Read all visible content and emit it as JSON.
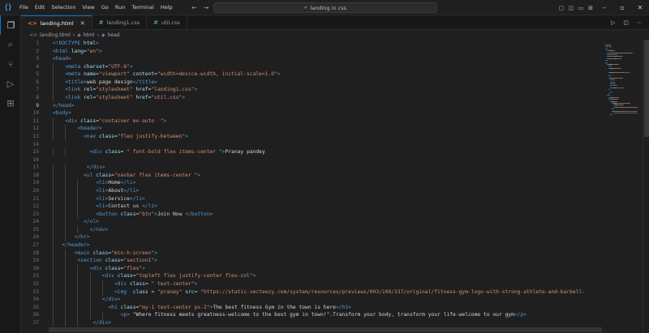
{
  "titlebar": {
    "menu": [
      "File",
      "Edit",
      "Selection",
      "View",
      "Go",
      "Run",
      "Terminal",
      "Help"
    ],
    "search_text": "landing in css"
  },
  "tabs": [
    {
      "label": "landing.html",
      "type": "html",
      "active": true
    },
    {
      "label": "landing1.css",
      "type": "css",
      "active": false
    },
    {
      "label": "util.css",
      "type": "css",
      "active": false
    }
  ],
  "breadcrumb": {
    "file": "landing.html",
    "el1": "html",
    "el2": "head"
  },
  "editor": {
    "current_line": 9,
    "lines": [
      {
        "n": "1",
        "indent": 0,
        "tokens": [
          [
            "t-doc",
            "<!DOCTYPE "
          ],
          [
            "t-attr",
            "html"
          ],
          [
            "t-doc",
            ">"
          ]
        ]
      },
      {
        "n": "2",
        "indent": 0,
        "tokens": [
          [
            "t-tag",
            "<html "
          ],
          [
            "t-attr",
            "lang"
          ],
          [
            "t-txt",
            "="
          ],
          [
            "t-str",
            "\"en\""
          ],
          [
            "t-tag",
            ">"
          ]
        ]
      },
      {
        "n": "3",
        "indent": 0,
        "tokens": [
          [
            "t-tag",
            "<head>"
          ]
        ]
      },
      {
        "n": "4",
        "indent": 1,
        "tokens": [
          [
            "t-tag",
            "<meta "
          ],
          [
            "t-attr",
            "charset"
          ],
          [
            "t-txt",
            "="
          ],
          [
            "t-str",
            "\"UTF-8\""
          ],
          [
            "t-tag",
            ">"
          ]
        ]
      },
      {
        "n": "5",
        "indent": 1,
        "tokens": [
          [
            "t-tag",
            "<meta "
          ],
          [
            "t-attr",
            "name"
          ],
          [
            "t-txt",
            "="
          ],
          [
            "t-str",
            "\"viewport\" "
          ],
          [
            "t-attr",
            "content"
          ],
          [
            "t-txt",
            "="
          ],
          [
            "t-str",
            "\"width=device-width, initial-scale=1.0\""
          ],
          [
            "t-tag",
            ">"
          ]
        ]
      },
      {
        "n": "6",
        "indent": 1,
        "tokens": [
          [
            "t-tag",
            "<title>"
          ],
          [
            "t-txt",
            "web page design"
          ],
          [
            "t-tag",
            "</title>"
          ]
        ]
      },
      {
        "n": "7",
        "indent": 1,
        "tokens": [
          [
            "t-tag",
            "<link "
          ],
          [
            "t-attr",
            "rel"
          ],
          [
            "t-txt",
            "="
          ],
          [
            "t-str",
            "\"stylesheet\" "
          ],
          [
            "t-attr",
            "href"
          ],
          [
            "t-txt",
            "="
          ],
          [
            "t-str",
            "\"landing1.css\""
          ],
          [
            "t-tag",
            ">"
          ]
        ]
      },
      {
        "n": "8",
        "indent": 1,
        "tokens": [
          [
            "t-tag",
            "<link "
          ],
          [
            "t-attr",
            "rel"
          ],
          [
            "t-txt",
            "="
          ],
          [
            "t-str",
            "\"stylesheet\" "
          ],
          [
            "t-attr",
            "href"
          ],
          [
            "t-txt",
            "="
          ],
          [
            "t-str",
            "\"util.css\""
          ],
          [
            "t-tag",
            ">"
          ]
        ]
      },
      {
        "n": "9",
        "indent": 0,
        "tokens": [
          [
            "t-tag",
            "</head>"
          ]
        ]
      },
      {
        "n": "10",
        "indent": 0,
        "tokens": [
          [
            "t-tag",
            "<body>"
          ]
        ]
      },
      {
        "n": "11",
        "indent": 1,
        "tokens": [
          [
            "t-tag",
            "<div "
          ],
          [
            "t-attr",
            "class"
          ],
          [
            "t-txt",
            "="
          ],
          [
            "t-str",
            "\"container mx-auto  \""
          ],
          [
            "t-tag",
            ">"
          ]
        ]
      },
      {
        "n": "12",
        "indent": 2,
        "tokens": [
          [
            "t-tag",
            "<header>"
          ]
        ]
      },
      {
        "n": "13",
        "indent": 2,
        "extra": 2,
        "tokens": [
          [
            "t-tag",
            "<nav "
          ],
          [
            "t-attr",
            "class"
          ],
          [
            "t-txt",
            "="
          ],
          [
            "t-str",
            "\"flex justify-between\""
          ],
          [
            "t-tag",
            ">"
          ]
        ]
      },
      {
        "n": "14",
        "indent": 0,
        "tokens": []
      },
      {
        "n": "15",
        "indent": 2,
        "extra": 4,
        "tokens": [
          [
            "t-tag",
            "<div "
          ],
          [
            "t-attr",
            "class"
          ],
          [
            "t-txt",
            "= "
          ],
          [
            "t-str",
            "\" font-bold flex items-center \""
          ],
          [
            "t-tag",
            ">"
          ],
          [
            "t-txt",
            "Pranay pandey"
          ]
        ]
      },
      {
        "n": "16",
        "indent": 0,
        "tokens": []
      },
      {
        "n": "17",
        "indent": 2,
        "extra": 3,
        "tokens": [
          [
            "t-tag",
            "</div>"
          ]
        ]
      },
      {
        "n": "18",
        "indent": 2,
        "extra": 2,
        "tokens": [
          [
            "t-tag",
            "<ul "
          ],
          [
            "t-attr",
            "class"
          ],
          [
            "t-txt",
            "="
          ],
          [
            "t-str",
            "\"navbar flex items-center \""
          ],
          [
            "t-tag",
            ">"
          ]
        ]
      },
      {
        "n": "19",
        "indent": 3,
        "extra": 2,
        "tokens": [
          [
            "t-tag",
            "<li>"
          ],
          [
            "t-txt",
            "Home"
          ],
          [
            "t-tag",
            "</li>"
          ]
        ]
      },
      {
        "n": "20",
        "indent": 3,
        "extra": 2,
        "tokens": [
          [
            "t-tag",
            "<li>"
          ],
          [
            "t-txt",
            "About"
          ],
          [
            "t-tag",
            "</li>"
          ]
        ]
      },
      {
        "n": "21",
        "indent": 3,
        "extra": 2,
        "tokens": [
          [
            "t-tag",
            "<li>"
          ],
          [
            "t-txt",
            "Service"
          ],
          [
            "t-tag",
            "</li>"
          ]
        ]
      },
      {
        "n": "22",
        "indent": 3,
        "extra": 2,
        "tokens": [
          [
            "t-tag",
            "<li>"
          ],
          [
            "t-txt",
            "Contact us "
          ],
          [
            "t-tag",
            "</li>"
          ]
        ]
      },
      {
        "n": "23",
        "indent": 3,
        "extra": 2,
        "tokens": [
          [
            "t-tag",
            "<button "
          ],
          [
            "t-attr",
            "class"
          ],
          [
            "t-txt",
            "="
          ],
          [
            "t-str",
            "\"btn\""
          ],
          [
            "t-tag",
            ">"
          ],
          [
            "t-txt",
            "Join Now "
          ],
          [
            "t-tag",
            "</button>"
          ]
        ]
      },
      {
        "n": "24",
        "indent": 2,
        "extra": 2,
        "tokens": [
          [
            "t-tag",
            "</ul>"
          ]
        ]
      },
      {
        "n": "25",
        "indent": 3,
        "extra": 0,
        "tokens": [
          [
            "t-tag",
            "</nav>"
          ]
        ]
      },
      {
        "n": "26",
        "indent": 2,
        "extra": -1,
        "tokens": [
          [
            "t-tag",
            "</hr>"
          ]
        ]
      },
      {
        "n": "27",
        "indent": 1,
        "extra": -1,
        "tokens": [
          [
            "t-tag",
            "</header>"
          ]
        ]
      },
      {
        "n": "28",
        "indent": 2,
        "extra": -1,
        "tokens": [
          [
            "t-tag",
            "<main "
          ],
          [
            "t-attr",
            "class"
          ],
          [
            "t-txt",
            "="
          ],
          [
            "t-str",
            "\"min-h-screen\""
          ],
          [
            "t-tag",
            ">"
          ]
        ]
      },
      {
        "n": "29",
        "indent": 2,
        "extra": 0,
        "tokens": [
          [
            "t-tag",
            "<section "
          ],
          [
            "t-attr",
            "class"
          ],
          [
            "t-txt",
            "="
          ],
          [
            "t-str",
            "\"section1\""
          ],
          [
            "t-tag",
            ">"
          ]
        ]
      },
      {
        "n": "30",
        "indent": 3,
        "extra": 0,
        "tokens": [
          [
            "t-tag",
            "<div "
          ],
          [
            "t-attr",
            "class"
          ],
          [
            "t-txt",
            "="
          ],
          [
            "t-str",
            "\"flex\""
          ],
          [
            "t-tag",
            ">"
          ]
        ]
      },
      {
        "n": "31",
        "indent": 4,
        "extra": 0,
        "tokens": [
          [
            "t-tag",
            "<div "
          ],
          [
            "t-attr",
            "class"
          ],
          [
            "t-txt",
            "="
          ],
          [
            "t-str",
            "\"topleft flex justify-center flex-col\""
          ],
          [
            "t-tag",
            ">"
          ]
        ]
      },
      {
        "n": "32",
        "indent": 5,
        "extra": 0,
        "tokens": [
          [
            "t-tag",
            "<div "
          ],
          [
            "t-attr",
            "class"
          ],
          [
            "t-txt",
            "= "
          ],
          [
            "t-str",
            "\" text-center\""
          ],
          [
            "t-tag",
            ">"
          ]
        ]
      },
      {
        "n": "33",
        "indent": 5,
        "extra": 0,
        "tokens": [
          [
            "t-tag",
            "<img  "
          ],
          [
            "t-attr",
            "class"
          ],
          [
            "t-txt",
            " = "
          ],
          [
            "t-str",
            "\"pranay\" "
          ],
          [
            "t-attr",
            "src"
          ],
          [
            "t-txt",
            "= "
          ],
          [
            "t-str",
            "\"https://static.vecteezy.com/system/resources/previews/003/108/337/original/fitness-gym-logo-with-strong-athlete-and-barbell-"
          ]
        ]
      },
      {
        "n": "34",
        "indent": 4,
        "extra": 0,
        "tokens": [
          [
            "t-tag",
            "</div>"
          ]
        ]
      },
      {
        "n": "35",
        "indent": 4,
        "extra": 2,
        "tokens": [
          [
            "t-tag",
            "<h1 "
          ],
          [
            "t-attr",
            "class"
          ],
          [
            "t-txt",
            "="
          ],
          [
            "t-str",
            "\"my-1 text-center px-2\""
          ],
          [
            "t-tag",
            ">"
          ],
          [
            "t-txt",
            "The best fitness Gym in the town is here"
          ],
          [
            "t-tag",
            "</h1>"
          ]
        ]
      },
      {
        "n": "36",
        "indent": 5,
        "extra": 2,
        "tokens": [
          [
            "t-tag",
            "<p> "
          ],
          [
            "t-txt",
            "\"Where fitness meets greatness-welcome to the best gym in town!\".Transform your body, transform your life-welcome to our gym"
          ],
          [
            "t-tag",
            "</p>"
          ]
        ]
      },
      {
        "n": "37",
        "indent": 3,
        "extra": 1,
        "tokens": [
          [
            "t-tag",
            "</div>"
          ]
        ]
      }
    ]
  },
  "colors": {
    "accent": "#0078d4",
    "tag": "#569cd6",
    "attr": "#9cdcfe",
    "string": "#ce9178"
  }
}
